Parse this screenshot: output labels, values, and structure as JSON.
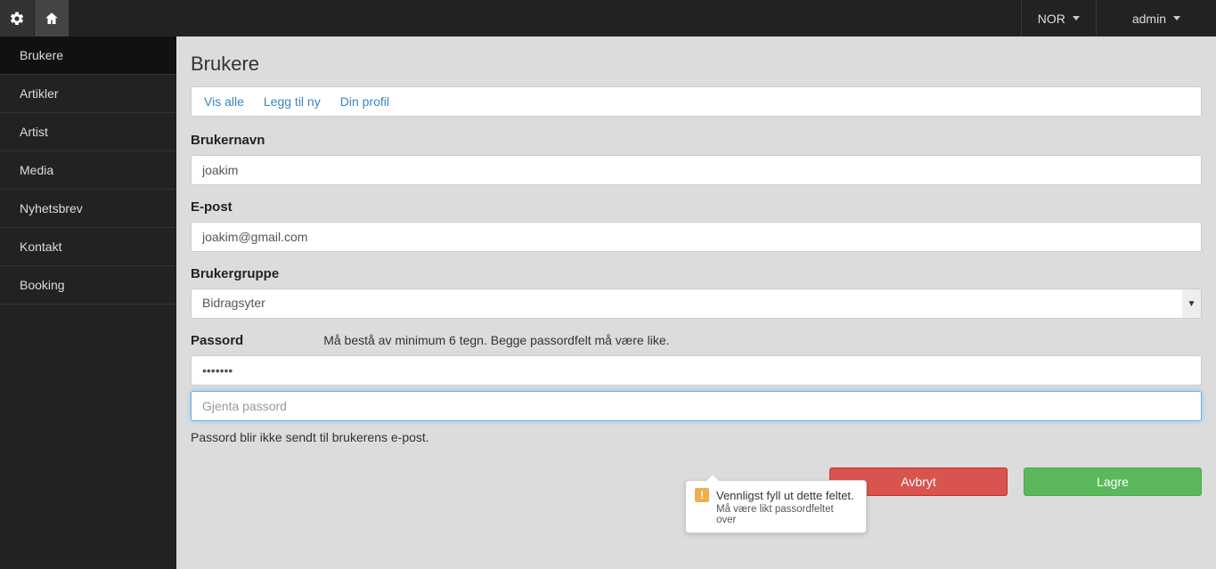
{
  "topbar": {
    "lang": "NOR",
    "user": "admin"
  },
  "sidebar": {
    "items": [
      {
        "label": "Brukere",
        "active": true
      },
      {
        "label": "Artikler"
      },
      {
        "label": "Artist"
      },
      {
        "label": "Media"
      },
      {
        "label": "Nyhetsbrev"
      },
      {
        "label": "Kontakt"
      },
      {
        "label": "Booking"
      }
    ]
  },
  "page": {
    "title": "Brukere"
  },
  "tabs": {
    "show_all": "Vis alle",
    "add_new": "Legg til ny",
    "your_profile": "Din profil"
  },
  "form": {
    "username_label": "Brukernavn",
    "username_value": "joakim",
    "email_label": "E-post",
    "email_value": "joakim@gmail.com",
    "group_label": "Brukergruppe",
    "group_selected": "Bidragsyter",
    "password_label": "Passord",
    "password_hint": "Må bestå av minimum 6 tegn. Begge passordfelt må være like.",
    "password_value": "•••••••",
    "password_repeat_placeholder": "Gjenta passord",
    "password_note": "Passord blir ikke sendt til brukerens e-post.",
    "cancel": "Avbryt",
    "save": "Lagre"
  },
  "tooltip": {
    "title": "Vennligst fyll ut dette feltet.",
    "sub": "Må være likt passordfeltet over"
  }
}
